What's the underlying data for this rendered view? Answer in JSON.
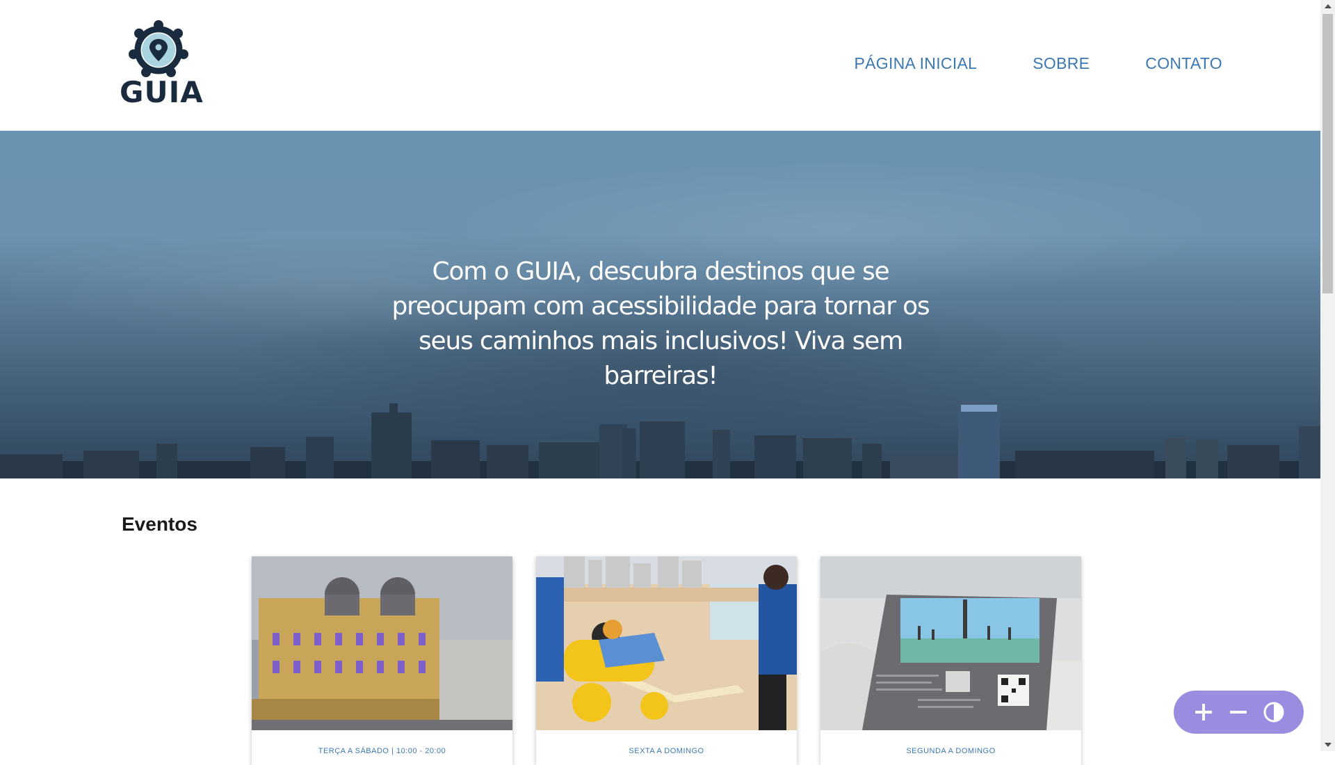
{
  "brand": {
    "name": "GUIA",
    "icon": "map-pin-community-logo"
  },
  "nav": {
    "items": [
      {
        "label": "PÁGINA INICIAL"
      },
      {
        "label": "SOBRE"
      },
      {
        "label": "CONTATO"
      }
    ]
  },
  "hero": {
    "text": "Com o GUIA, descubra destinos que se preocupam com acessibilidade para tornar os seus caminhos mais inclusivos! Viva sem barreiras!"
  },
  "events": {
    "title": "Eventos",
    "cards": [
      {
        "caption": "TERÇA A SÁBADO | 10:00 - 20:00",
        "image": "illuminated-historic-building"
      },
      {
        "caption": "SEXTA A DOMINGO",
        "image": "beach-accessible-wheelchair"
      },
      {
        "caption": "SEGUNDA A DOMINGO",
        "image": "tactile-braille-sign-qr-code"
      }
    ]
  },
  "accessibility": {
    "controls": [
      {
        "icon": "plus-icon"
      },
      {
        "icon": "minus-icon"
      },
      {
        "icon": "contrast-icon"
      }
    ]
  },
  "colors": {
    "nav_link": "#3b78b3",
    "logo_dark": "#1b2b3e",
    "widget_bg": "#9a8ce0"
  }
}
